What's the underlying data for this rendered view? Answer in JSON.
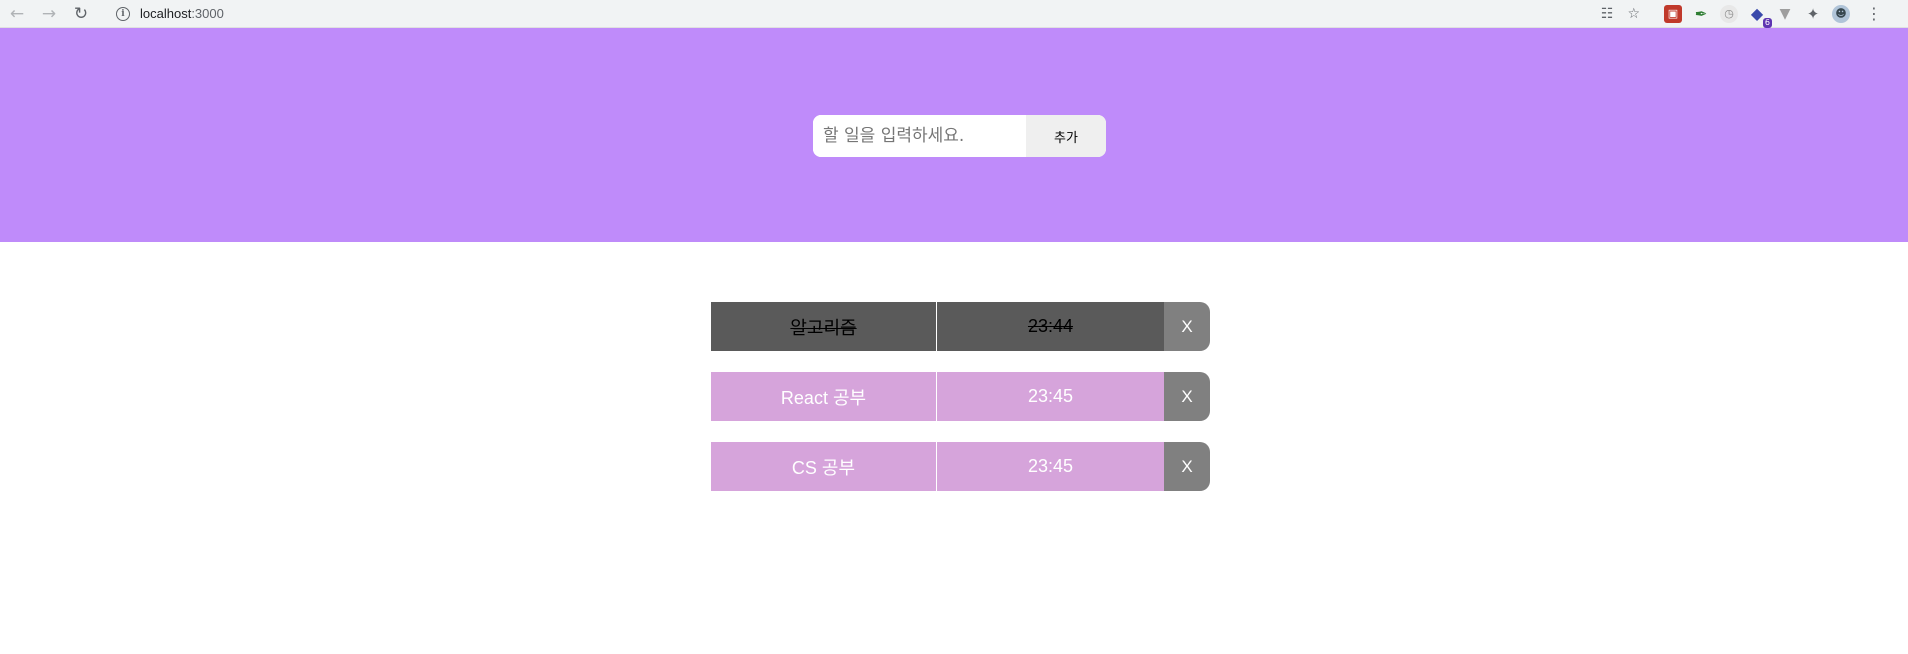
{
  "browser": {
    "url_host": "localhost",
    "url_port": ":3000",
    "back_icon": "arrow-left-icon",
    "forward_icon": "arrow-right-icon",
    "reload_icon": "reload-icon",
    "extension_badge": "6"
  },
  "form": {
    "placeholder": "할 일을 입력하세요.",
    "submit_label": "추가"
  },
  "todos": [
    {
      "text": "알고리즘",
      "time": "23:44",
      "done": true,
      "delete_label": "X"
    },
    {
      "text": "React 공부",
      "time": "23:45",
      "done": false,
      "delete_label": "X"
    },
    {
      "text": "CS 공부",
      "time": "23:45",
      "done": false,
      "delete_label": "X"
    }
  ],
  "colors": {
    "header_bg": "#bf8bfa",
    "done_bg": "#5a5a5a",
    "active_bg": "#d6a4db",
    "delete_bg": "#808080"
  }
}
